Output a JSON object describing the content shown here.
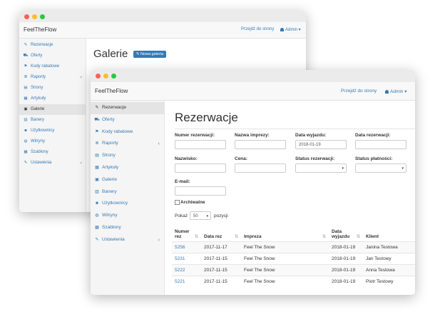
{
  "back_window": {
    "brand": "FeelTheFlow",
    "nav_goto": "Przejdź do strony",
    "nav_admin": "Admin",
    "page_title": "Galerie",
    "new_button": "Nowa galeria",
    "sidebar": [
      {
        "label": "Rezerwacje",
        "icon": "wrench-icon",
        "glyph": "✎"
      },
      {
        "label": "Oferty",
        "icon": "cart-icon",
        "glyph": "⛟"
      },
      {
        "label": "Kody rabatowe",
        "icon": "tag-icon",
        "glyph": "⚑"
      },
      {
        "label": "Raporty",
        "icon": "list-icon",
        "glyph": "≣"
      },
      {
        "label": "Strony",
        "icon": "file-icon",
        "glyph": "▤"
      },
      {
        "label": "Artykuły",
        "icon": "article-icon",
        "glyph": "▦"
      },
      {
        "label": "Galerie",
        "icon": "picture-icon",
        "glyph": "▣"
      },
      {
        "label": "Banery",
        "icon": "banner-icon",
        "glyph": "▥"
      },
      {
        "label": "Użytkownicy",
        "icon": "users-icon",
        "glyph": "☻"
      },
      {
        "label": "Witryny",
        "icon": "globe-icon",
        "glyph": "◍"
      },
      {
        "label": "Szablony",
        "icon": "template-icon",
        "glyph": "▦"
      },
      {
        "label": "Ustawienia",
        "icon": "settings-icon",
        "glyph": "✎"
      }
    ]
  },
  "front_window": {
    "brand": "FeelTheFlow",
    "nav_goto": "Przejdź do strony",
    "nav_admin": "Admin",
    "page_title": "Rezerwacje",
    "sidebar": [
      {
        "label": "Rezerwacje",
        "icon": "wrench-icon",
        "glyph": "✎"
      },
      {
        "label": "Oferty",
        "icon": "cart-icon",
        "glyph": "⛟"
      },
      {
        "label": "Kody rabatowe",
        "icon": "tag-icon",
        "glyph": "⚑"
      },
      {
        "label": "Raporty",
        "icon": "list-icon",
        "glyph": "≣"
      },
      {
        "label": "Strony",
        "icon": "file-icon",
        "glyph": "▤"
      },
      {
        "label": "Artykuły",
        "icon": "article-icon",
        "glyph": "▦"
      },
      {
        "label": "Galerie",
        "icon": "picture-icon",
        "glyph": "▣"
      },
      {
        "label": "Banery",
        "icon": "banner-icon",
        "glyph": "▥"
      },
      {
        "label": "Użytkownicy",
        "icon": "users-icon",
        "glyph": "☻"
      },
      {
        "label": "Witryny",
        "icon": "globe-icon",
        "glyph": "◍"
      },
      {
        "label": "Szablony",
        "icon": "template-icon",
        "glyph": "▦"
      },
      {
        "label": "Ustawienia",
        "icon": "settings-icon",
        "glyph": "✎"
      }
    ],
    "filters": {
      "numer_label": "Numer rezerwacji:",
      "impreza_label": "Nazwa imprezy:",
      "wyjazd_label": "Data wyjazdu:",
      "wyjazd_value": "2018-01-19",
      "data_rez_label": "Data rezerwacji:",
      "nazwisko_label": "Nazwisko:",
      "cena_label": "Cena:",
      "status_rez_label": "Status rezerwacji:",
      "status_plat_label": "Status płatności:",
      "email_label": "E-mail:",
      "archiwalne_label": "Archiwalne"
    },
    "show_prefix": "Pokaż",
    "show_value": "50",
    "show_suffix": "pozycji",
    "table": {
      "headers": {
        "numer1": "Numer",
        "numer2": "rez",
        "data_rez": "Data rez",
        "impreza": "Impreza",
        "wyjazd1": "Data",
        "wyjazd2": "wyjazdu",
        "klient": "Klient"
      },
      "rows": [
        {
          "numer": "5256",
          "data_rez": "2017-11-17",
          "impreza": "Feel The Snow",
          "wyjazd": "2018-01-19",
          "klient": "Janina Testowa"
        },
        {
          "numer": "5231",
          "data_rez": "2017-11-15",
          "impreza": "Feel The Snow",
          "wyjazd": "2018-01-19",
          "klient": "Jan Testowy"
        },
        {
          "numer": "5222",
          "data_rez": "2017-11-15",
          "impreza": "Feel The Snow",
          "wyjazd": "2018-01-19",
          "klient": "Anna Testowa"
        },
        {
          "numer": "5221",
          "data_rez": "2017-11-15",
          "impreza": "Feel The Snow",
          "wyjazd": "2018-01-19",
          "klient": "Piotr Testowy"
        }
      ]
    }
  }
}
